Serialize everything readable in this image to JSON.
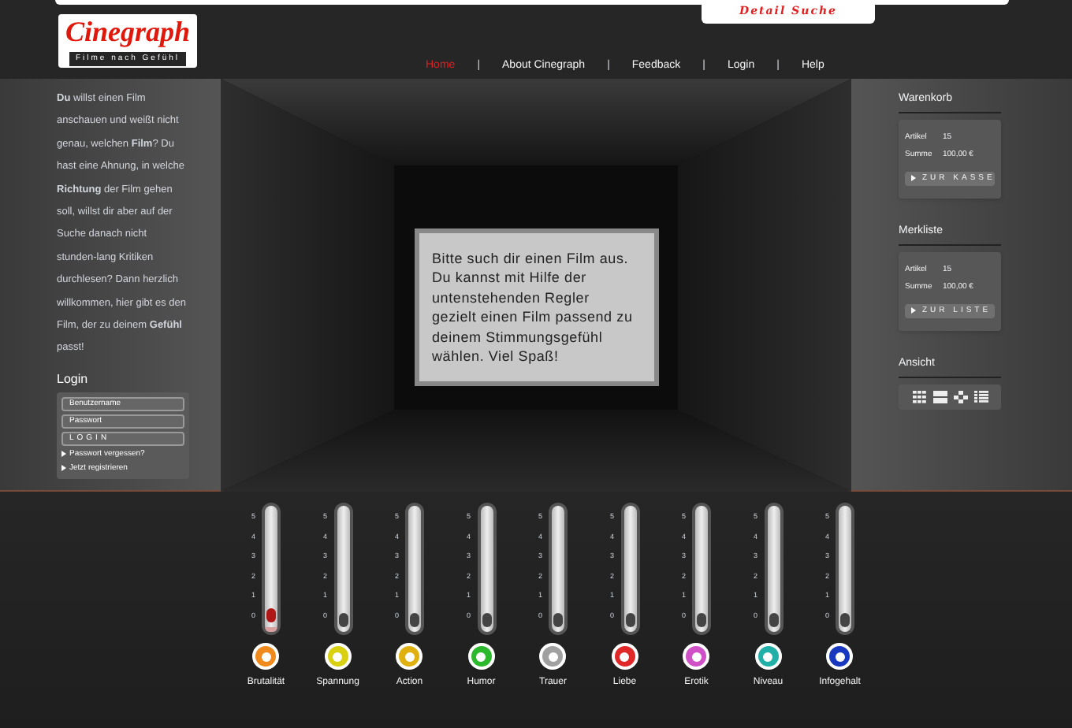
{
  "header": {
    "logo": "Cinegraph",
    "tagline": "Filme nach Gefühl",
    "detail_search": "Detail Suche",
    "nav": [
      {
        "label": "Home",
        "selected": true
      },
      {
        "label": "About Cinegraph",
        "selected": false
      },
      {
        "label": "Feedback",
        "selected": false
      },
      {
        "label": "Login",
        "selected": false
      },
      {
        "label": "Help",
        "selected": false
      }
    ],
    "separator": "|"
  },
  "intro": "**Du** willst einen Film anschauen und weißt nicht genau, welchen **Film**? Du hast eine Ahnung, in welche **Richtung** der Film gehen soll, willst dir aber auf der Suche danach nicht stunden-lang Kritiken durchlesen? Dann herzlich willkommen, hier gibt es den Film, der zu deinem **Gefühl** passt!",
  "login": {
    "title": "Login",
    "username_placeholder": "Benutzername",
    "password_placeholder": "Passwort",
    "button": "LOGIN",
    "links": [
      "Passwort vergessen?",
      "Jetzt registrieren"
    ]
  },
  "message": "Bitte such dir einen Film aus. Du kannst mit Hilfe der untenstehenden Regler gezielt einen Film passend zu deinem Stimmungsgefühl wählen. Viel Spaß!",
  "cart": {
    "title": "Warenkorb",
    "rows": [
      {
        "label": "Artikel",
        "value": "15"
      },
      {
        "label": "Summe",
        "value": "100,00 €"
      }
    ],
    "button": "ZUR KASSE"
  },
  "watchlist": {
    "title": "Merkliste",
    "rows": [
      {
        "label": "Artikel",
        "value": "15"
      },
      {
        "label": "Summe",
        "value": "100,00 €"
      }
    ],
    "button": "ZUR LISTE"
  },
  "view": {
    "title": "Ansicht"
  },
  "sliders": [
    {
      "label": "Brutalität",
      "level": 0.04,
      "color": "#f08a1c",
      "scale": [
        "5",
        "4",
        "3",
        "2",
        "1",
        "0"
      ]
    },
    {
      "label": "Spannung",
      "level": 0,
      "color": "#d8d010",
      "scale": [
        "5",
        "4",
        "3",
        "2",
        "1",
        "0"
      ]
    },
    {
      "label": "Action",
      "level": 0,
      "color": "#e0b010",
      "scale": [
        "5",
        "4",
        "3",
        "2",
        "1",
        "0"
      ]
    },
    {
      "label": "Humor",
      "level": 0,
      "color": "#2cb82c",
      "scale": [
        "5",
        "4",
        "3",
        "2",
        "1",
        "0"
      ]
    },
    {
      "label": "Trauer",
      "level": 0,
      "color": "#a0a0a0",
      "scale": [
        "5",
        "4",
        "3",
        "2",
        "1",
        "0"
      ]
    },
    {
      "label": "Liebe",
      "level": 0,
      "color": "#e02828",
      "scale": [
        "5",
        "4",
        "3",
        "2",
        "1",
        "0"
      ]
    },
    {
      "label": "Erotik",
      "level": 0,
      "color": "#d050c8",
      "scale": [
        "5",
        "4",
        "3",
        "2",
        "1",
        "0"
      ]
    },
    {
      "label": "Niveau",
      "level": 0,
      "color": "#20b0a8",
      "scale": [
        "5",
        "4",
        "3",
        "2",
        "1",
        "0"
      ]
    },
    {
      "label": "Infogehalt",
      "level": 0,
      "color": "#1838c0",
      "scale": [
        "5",
        "4",
        "3",
        "2",
        "1",
        "0"
      ]
    }
  ]
}
